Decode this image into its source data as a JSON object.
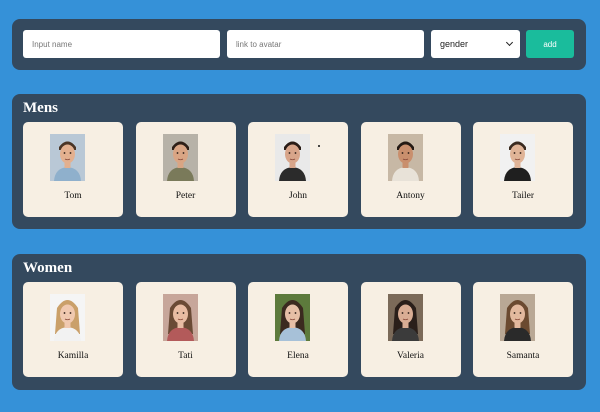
{
  "form": {
    "name_placeholder": "Input name",
    "avatar_placeholder": "link to avatar",
    "gender_selected": "gender",
    "add_label": "add"
  },
  "colors": {
    "page_bg": "#3591d8",
    "panel_bg": "#34495e",
    "card_bg": "#f7efe3",
    "add_button": "#1abc9c"
  },
  "mens": {
    "title": "Mens",
    "people": [
      {
        "name": "Tom",
        "skin": "#e3b08f",
        "hair": "#4a3526",
        "bg": "#b9c8d6",
        "shirt": "#8fb0cc"
      },
      {
        "name": "Peter",
        "skin": "#d9a584",
        "hair": "#2e2018",
        "bg": "#b7b2a8",
        "shirt": "#7a7a5a"
      },
      {
        "name": "John",
        "skin": "#d8a58a",
        "hair": "#2a1d17",
        "bg": "#e9e9e9",
        "shirt": "#2b2b2b"
      },
      {
        "name": "Antony",
        "skin": "#c98f6d",
        "hair": "#241a14",
        "bg": "#c7b8a5",
        "shirt": "#e8e2d8"
      },
      {
        "name": "Tailer",
        "skin": "#e0b497",
        "hair": "#3a2b20",
        "bg": "#f1f1f1",
        "shirt": "#1f1f1f"
      }
    ]
  },
  "women": {
    "title": "Women",
    "people": [
      {
        "name": "Kamilla",
        "skin": "#f0c9b0",
        "hair": "#caa06a",
        "bg": "#f5f5f5",
        "shirt": "#f2f2f2"
      },
      {
        "name": "Tati",
        "skin": "#e8bca3",
        "hair": "#6a4a35",
        "bg": "#c7a69a",
        "shirt": "#b35a5a"
      },
      {
        "name": "Elena",
        "skin": "#e6bfa6",
        "hair": "#3b2a1f",
        "bg": "#5d7a3c",
        "shirt": "#a7c1d8"
      },
      {
        "name": "Valeria",
        "skin": "#d9ad94",
        "hair": "#2a1f1a",
        "bg": "#7b6a59",
        "shirt": "#3b3b3b"
      },
      {
        "name": "Samanta",
        "skin": "#e3b99e",
        "hair": "#6b4a30",
        "bg": "#b9a895",
        "shirt": "#2a2a2a"
      }
    ]
  }
}
